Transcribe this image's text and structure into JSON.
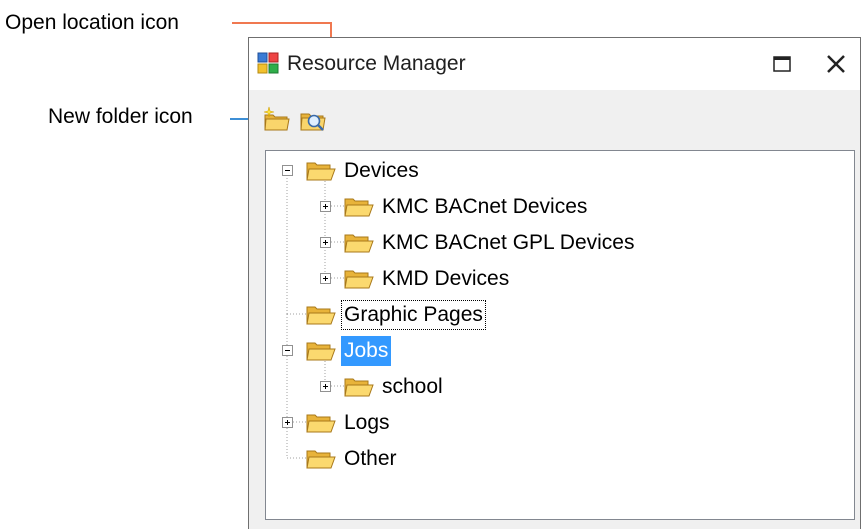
{
  "callouts": {
    "open_location": "Open location icon",
    "new_folder": "New folder icon",
    "open_location_color": "#f07850",
    "new_folder_color": "#3d8fd6"
  },
  "window": {
    "title": "Resource Manager",
    "maximize_icon": "maximize-icon",
    "close_icon": "close-icon"
  },
  "toolbar": {
    "new_folder_icon": "new-folder-icon",
    "open_location_icon": "open-location-icon"
  },
  "tree": {
    "nodes": [
      {
        "label": "Devices",
        "expander": "minus"
      },
      {
        "label": "KMC BACnet Devices",
        "expander": "plus"
      },
      {
        "label": "KMC BACnet GPL Devices",
        "expander": "plus"
      },
      {
        "label": "KMD Devices",
        "expander": "plus"
      },
      {
        "label": "Graphic Pages",
        "expander": "none",
        "state": "focused"
      },
      {
        "label": "Jobs",
        "expander": "minus",
        "state": "selected"
      },
      {
        "label": "school",
        "expander": "plus"
      },
      {
        "label": "Logs",
        "expander": "plus"
      },
      {
        "label": "Other",
        "expander": "none"
      }
    ],
    "selection_color": "#3399ff",
    "folder_color": "#f5c542"
  }
}
